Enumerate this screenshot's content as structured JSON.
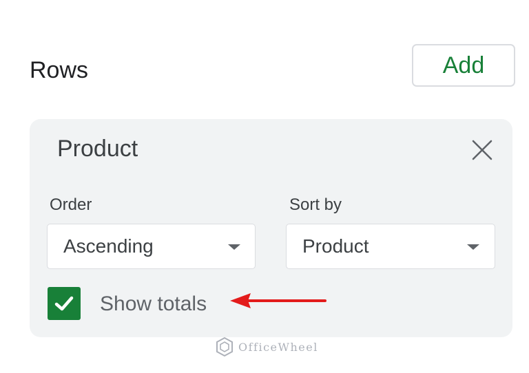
{
  "section": {
    "title": "Rows",
    "add_label": "Add"
  },
  "field_card": {
    "title": "Product",
    "order": {
      "label": "Order",
      "value": "Ascending"
    },
    "sort_by": {
      "label": "Sort by",
      "value": "Product"
    },
    "show_totals": {
      "label": "Show totals",
      "checked": true
    }
  },
  "watermark": {
    "text": "OfficeWheel"
  },
  "colors": {
    "accent_green": "#188038",
    "card_background": "#f1f3f4",
    "annotation_red": "#e31b1b"
  },
  "icons": {
    "close": "close-icon",
    "dropdown": "dropdown-arrow-icon",
    "check": "check-icon",
    "annotation": "red-arrow-icon",
    "logo": "officewheel-logo-icon"
  }
}
